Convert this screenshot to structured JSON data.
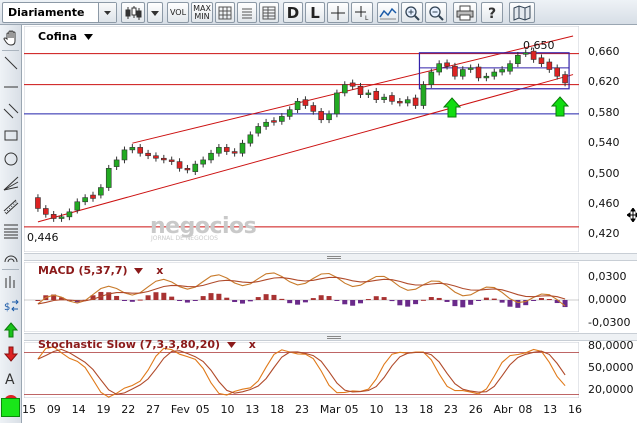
{
  "toolbar": {
    "period_value": "Diariamente",
    "vol_label": "VOL",
    "maxmin_label_1": "MAX",
    "maxmin_label_2": "MIN",
    "d_label": "D",
    "l_label": "L"
  },
  "instrument": {
    "name": "Cofina"
  },
  "price_chart": {
    "yticks": [
      "0,660",
      "0,620",
      "0,580",
      "0,540",
      "0,500",
      "0,460",
      "0,420"
    ],
    "high_label": "0,650",
    "low_label": "0,446",
    "watermark_main": "negocios",
    "watermark_sub": "JORNAL DE NEGOCIOS"
  },
  "macd": {
    "title": "MACD (5,37,7)",
    "close_label": "x",
    "yticks": [
      "0,0300",
      "0,0000",
      "-0,0300"
    ]
  },
  "stochastic": {
    "title": "Stochastic Slow (7,3,3,80,20)",
    "close_label": "x",
    "yticks": [
      "80,0000",
      "50,0000",
      "20,0000"
    ]
  },
  "xaxis": {
    "ticks": [
      "15",
      "09",
      "14",
      "19",
      "22",
      "27",
      "Fev",
      "05",
      "10",
      "13",
      "18",
      "23",
      "Mar",
      "05",
      "10",
      "13",
      "18",
      "23",
      "26",
      "Abr",
      "08",
      "13",
      "16"
    ]
  },
  "chart_data": {
    "type": "candlestick",
    "title": "Cofina",
    "x_categories": [
      "15",
      "09",
      "14",
      "19",
      "22",
      "27",
      "Fev",
      "05",
      "10",
      "13",
      "18",
      "23",
      "Mar",
      "05",
      "10",
      "13",
      "18",
      "23",
      "26",
      "Abr",
      "08",
      "13",
      "16"
    ],
    "ylim": [
      0.41,
      0.68
    ],
    "closes": [
      0.462,
      0.455,
      0.45,
      0.452,
      0.458,
      0.47,
      0.475,
      0.474,
      0.487,
      0.51,
      0.52,
      0.532,
      0.535,
      0.528,
      0.525,
      0.522,
      0.52,
      0.518,
      0.51,
      0.508,
      0.515,
      0.52,
      0.528,
      0.535,
      0.53,
      0.528,
      0.54,
      0.55,
      0.56,
      0.565,
      0.565,
      0.572,
      0.58,
      0.59,
      0.585,
      0.578,
      0.568,
      0.575,
      0.6,
      0.61,
      0.608,
      0.598,
      0.6,
      0.592,
      0.595,
      0.59,
      0.588,
      0.592,
      0.585,
      0.61,
      0.625,
      0.635,
      0.632,
      0.62,
      0.628,
      0.63,
      0.618,
      0.62,
      0.625,
      0.628,
      0.635,
      0.645,
      0.648,
      0.64,
      0.635,
      0.628,
      0.62,
      0.612
    ],
    "opens": [
      0.475,
      0.462,
      0.455,
      0.45,
      0.452,
      0.46,
      0.47,
      0.478,
      0.478,
      0.487,
      0.512,
      0.52,
      0.532,
      0.535,
      0.528,
      0.525,
      0.522,
      0.52,
      0.518,
      0.51,
      0.506,
      0.515,
      0.52,
      0.528,
      0.535,
      0.53,
      0.528,
      0.54,
      0.552,
      0.56,
      0.567,
      0.566,
      0.572,
      0.58,
      0.592,
      0.585,
      0.578,
      0.568,
      0.575,
      0.6,
      0.612,
      0.608,
      0.598,
      0.602,
      0.592,
      0.597,
      0.59,
      0.588,
      0.594,
      0.585,
      0.61,
      0.625,
      0.636,
      0.632,
      0.62,
      0.628,
      0.631,
      0.618,
      0.62,
      0.625,
      0.626,
      0.635,
      0.647,
      0.65,
      0.642,
      0.637,
      0.63,
      0.622
    ],
    "horizontal_levels": [
      0.647,
      0.61,
      0.575,
      0.44
    ],
    "trend_channel": {
      "lower_start": 0.446,
      "lower_end": 0.622,
      "upper_start": 0.54,
      "upper_end": 0.668
    },
    "annotations": {
      "high": "0,650",
      "low": "0,446"
    },
    "macd": {
      "ylim": [
        -0.04,
        0.04
      ]
    },
    "stochastic": {
      "ylim": [
        15,
        95
      ],
      "levels": [
        80,
        20
      ]
    },
    "colors": {
      "up": "#22aa22",
      "down": "#dd2222",
      "channel": "#cc1111",
      "support": "#2222aa",
      "box": "#3322aa",
      "arrow": "#11dd11"
    }
  }
}
